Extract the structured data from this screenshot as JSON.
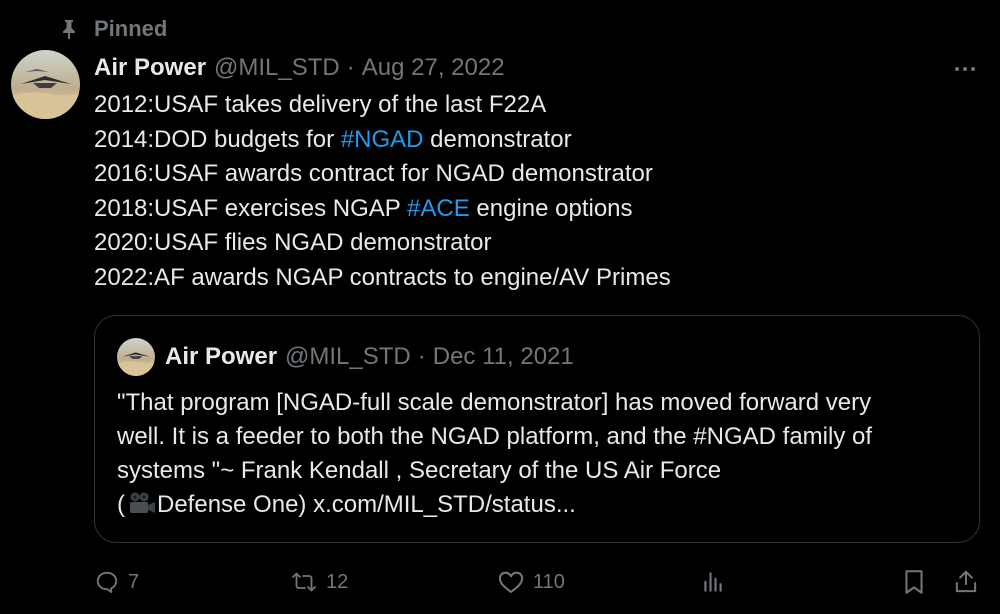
{
  "pinned": {
    "icon": "pin-icon",
    "label": "Pinned"
  },
  "tweet": {
    "author": {
      "display_name": "Air Power",
      "handle": "@MIL_STD",
      "avatar": "avatar"
    },
    "separator": "·",
    "date": "Aug 27, 2022",
    "more_icon": "more-icon",
    "lines": [
      {
        "parts": [
          {
            "text": "2012:USAF takes delivery of the last F22A"
          }
        ]
      },
      {
        "parts": [
          {
            "text": "2014:DOD budgets for "
          },
          {
            "text": "#NGAD",
            "hashtag": true
          },
          {
            "text": " demonstrator"
          }
        ]
      },
      {
        "parts": [
          {
            "text": "2016:USAF awards contract for NGAD demonstrator"
          }
        ]
      },
      {
        "parts": [
          {
            "text": "2018:USAF exercises NGAP "
          },
          {
            "text": "#ACE",
            "hashtag": true
          },
          {
            "text": " engine options"
          }
        ]
      },
      {
        "parts": [
          {
            "text": "2020:USAF flies NGAD demonstrator"
          }
        ]
      },
      {
        "parts": [
          {
            "text": "2022:AF awards NGAP contracts to engine/AV Primes"
          }
        ]
      }
    ],
    "quote": {
      "author": {
        "display_name": "Air Power",
        "handle": "@MIL_STD"
      },
      "separator": "·",
      "date": "Dec 11, 2021",
      "lines": [
        "\"That program [NGAD-full scale demonstrator] has moved forward very",
        "well. It is a feeder to both the NGAD platform, and the #NGAD family of",
        "systems \"~ Frank Kendall , Secretary of the US Air Force"
      ],
      "last_line": {
        "before_emoji": "(",
        "emoji": "movie-camera-emoji",
        "after_emoji": "Defense One) x.com/MIL_STD/status..."
      }
    },
    "actions": {
      "reply": {
        "icon": "reply-icon",
        "count": "7"
      },
      "retweet": {
        "icon": "retweet-icon",
        "count": "12"
      },
      "like": {
        "icon": "like-icon",
        "count": "110"
      },
      "views": {
        "icon": "views-icon"
      },
      "bookmark": {
        "icon": "bookmark-icon"
      },
      "share": {
        "icon": "share-icon"
      }
    }
  },
  "colors": {
    "background": "#000000",
    "text_primary": "#e7e9ea",
    "text_secondary": "#71767b",
    "hashtag": "#1d9bf0",
    "border": "#2f3336"
  }
}
